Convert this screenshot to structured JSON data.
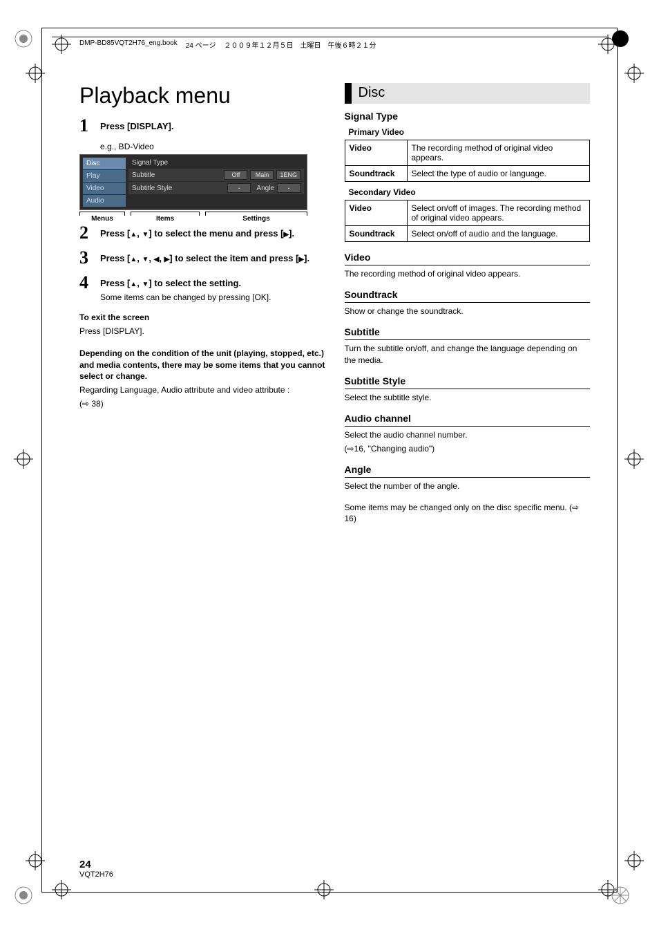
{
  "header": {
    "book": "DMP-BD85VQT2H76_eng.book",
    "page_info": "24 ページ",
    "date": "２００９年１２月５日　土曜日　午後６時２１分"
  },
  "title": "Playback menu",
  "steps": {
    "s1": {
      "num": "1",
      "text": "Press [DISPLAY]."
    },
    "s2": {
      "num": "2",
      "text_a": "Press [",
      "text_b": ", ",
      "text_c": "] to select the menu and press [",
      "text_d": "]."
    },
    "s3": {
      "num": "3",
      "text_a": "Press [",
      "text_b": ", ",
      "text_c": ", ",
      "text_d": ", ",
      "text_e": "] to select the item and press [",
      "text_f": "]."
    },
    "s4": {
      "num": "4",
      "text_a": "Press [",
      "text_b": ", ",
      "text_c": "] to select the setting.",
      "sub": "Some items can be changed by pressing [OK]."
    }
  },
  "eg": "e.g., BD-Video",
  "osd": {
    "menus": [
      "Disc",
      "Play",
      "Video",
      "Audio"
    ],
    "rows": [
      {
        "label": "Signal Type",
        "vals": []
      },
      {
        "label": "Subtitle",
        "vals": [
          "Off",
          "Main",
          "1ENG"
        ]
      },
      {
        "label": "Subtitle Style",
        "vals": [
          "-"
        ],
        "extra_label": "Angle",
        "extra_val": "-"
      }
    ],
    "brackets": {
      "menus": "Menus",
      "items": "Items",
      "settings": "Settings"
    }
  },
  "exit": {
    "h": "To exit the screen",
    "p": "Press [DISPLAY]."
  },
  "note": {
    "b": "Depending on the condition of the unit (playing, stopped, etc.) and media contents, there may be some items that you cannot select or change.",
    "p": "Regarding Language, Audio attribute and video attribute :",
    "ref": "(⇨ 38)"
  },
  "right": {
    "section": "Disc",
    "signal_type": "Signal Type",
    "primary_video": "Primary Video",
    "table1": {
      "r1k": "Video",
      "r1v": "The recording method of original video appears.",
      "r2k": "Soundtrack",
      "r2v": "Select the type of audio or language."
    },
    "secondary_video": "Secondary Video",
    "table2": {
      "r1k": "Video",
      "r1v": "Select on/off of images. The recording method of original video appears.",
      "r2k": "Soundtrack",
      "r2v": "Select on/off of audio and the language."
    },
    "video": {
      "h": "Video",
      "p": "The recording method of original video appears."
    },
    "soundtrack": {
      "h": "Soundtrack",
      "p": "Show or change the soundtrack."
    },
    "subtitle": {
      "h": "Subtitle",
      "p": "Turn the subtitle on/off, and change the language depending on the media."
    },
    "subtitle_style": {
      "h": "Subtitle Style",
      "p": "Select the subtitle style."
    },
    "audio_channel": {
      "h": "Audio channel",
      "p1": "Select the audio channel number.",
      "p2": "(⇨16, \"Changing audio\")"
    },
    "angle": {
      "h": "Angle",
      "p": "Select the number of the angle."
    },
    "footnote": "Some items may be changed only on the disc specific menu. (⇨ 16)"
  },
  "page": {
    "num": "24",
    "code": "VQT2H76"
  }
}
